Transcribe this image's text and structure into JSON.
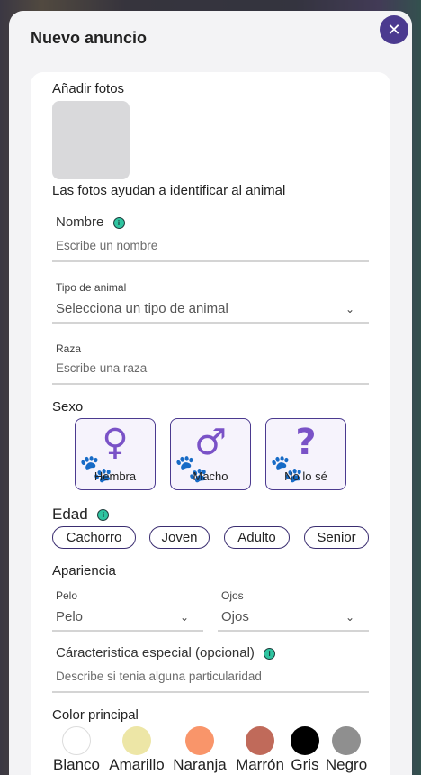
{
  "modal": {
    "title": "Nuevo anuncio",
    "close_icon": "close-icon"
  },
  "photos": {
    "label": "Añadir fotos",
    "hint": "Las fotos ayudan a identificar al animal"
  },
  "name": {
    "label": "Nombre",
    "placeholder": "Escribe un nombre"
  },
  "animal_type": {
    "label": "Tipo de animal",
    "value": "Selecciona un tipo de animal"
  },
  "breed": {
    "label": "Raza",
    "placeholder": "Escribe una raza"
  },
  "sex": {
    "label": "Sexo",
    "options": [
      {
        "label": "Hembra",
        "icon": "female-icon"
      },
      {
        "label": "Macho",
        "icon": "male-icon"
      },
      {
        "label": "No lo sé",
        "icon": "question-icon"
      }
    ]
  },
  "age": {
    "label": "Edad",
    "options": [
      "Cachorro",
      "Joven",
      "Adulto",
      "Senior"
    ]
  },
  "appearance": {
    "label": "Apariencia",
    "hair": {
      "label": "Pelo",
      "value": "Pelo"
    },
    "eyes": {
      "label": "Ojos",
      "value": "Ojos"
    }
  },
  "special": {
    "label": "Cáracteristica especial (opcional)",
    "placeholder": "Describe si tenia alguna particularidad"
  },
  "color": {
    "label": "Color principal",
    "options": [
      {
        "label": "Blanco",
        "hex": "#ffffff"
      },
      {
        "label": "Amarillo",
        "hex": "#ede6a6"
      },
      {
        "label": "Naranja",
        "hex": "#f9956a"
      },
      {
        "label": "Marrón",
        "hex": "#c06a5a"
      },
      {
        "label": "Gris",
        "hex": "#000000"
      },
      {
        "label": "Negro",
        "hex": "#8f8f8f"
      }
    ]
  },
  "accent": "#4b3a8f"
}
